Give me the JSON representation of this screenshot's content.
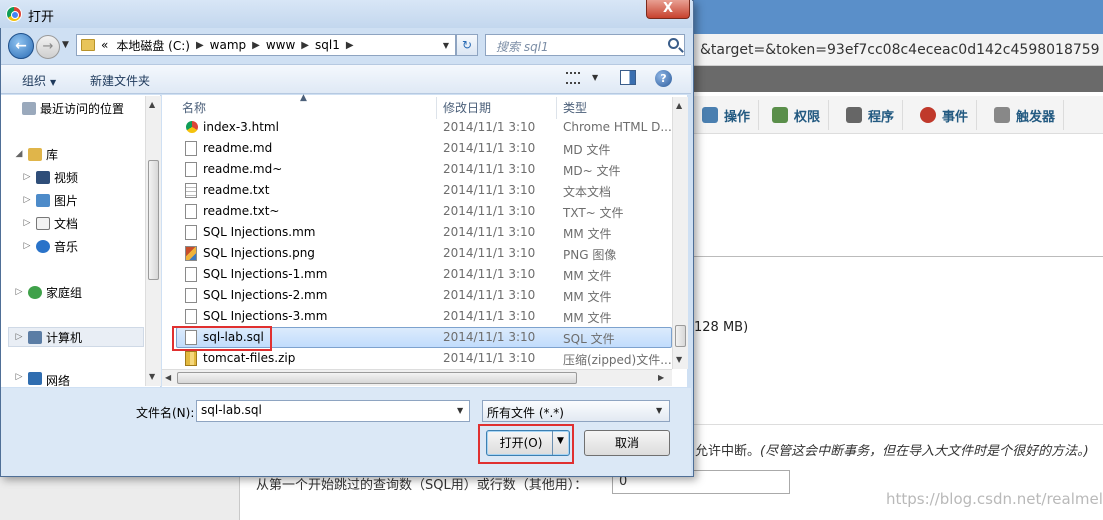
{
  "background": {
    "url_fragment": "&target=&token=93ef7cc08c4eceac0d142c4598018759",
    "tabs": [
      {
        "label": "操作",
        "color": "#4a7fb0"
      },
      {
        "label": "权限",
        "color": "#5a8f4a"
      },
      {
        "label": "程序",
        "color": "#666666"
      },
      {
        "label": "事件",
        "color": "#c0392b"
      },
      {
        "label": "触发器",
        "color": "#888888"
      }
    ],
    "size_text": "128 MB)",
    "note_prefix": "则允许中断。",
    "note_italic": "(尽管这会中断事务，但在导入大文件时是个很好的方法。)",
    "skip_label": "从第一个开始跳过的查询数（SQL用）或行数（其他用）：",
    "skip_value": "0",
    "watermark": "https://blog.csdn.net/realmels"
  },
  "dialog": {
    "title": "打开",
    "close_label": "X",
    "address": {
      "prefix": "«",
      "segments": [
        "本地磁盘 (C:)",
        "wamp",
        "www",
        "sql1"
      ]
    },
    "search_placeholder": "搜索 sql1",
    "toolbar": {
      "organize": "组织",
      "new_folder": "新建文件夹"
    },
    "nav_items": [
      {
        "label": "最近访问的位置",
        "icon": "recent-places-icon",
        "arrow": ""
      },
      {
        "label": "库",
        "icon": "library-icon",
        "arrow": "◢"
      },
      {
        "label": "视频",
        "icon": "video-icon",
        "arrow": "▷"
      },
      {
        "label": "图片",
        "icon": "pictures-icon",
        "arrow": "▷"
      },
      {
        "label": "文档",
        "icon": "documents-icon",
        "arrow": "▷"
      },
      {
        "label": "音乐",
        "icon": "music-icon",
        "arrow": "▷"
      },
      {
        "label": "家庭组",
        "icon": "homegroup-icon",
        "arrow": "▷"
      },
      {
        "label": "计算机",
        "icon": "computer-icon",
        "arrow": "▷"
      },
      {
        "label": "网络",
        "icon": "network-icon",
        "arrow": "▷"
      }
    ],
    "columns": {
      "name": "名称",
      "date": "修改日期",
      "type": "类型"
    },
    "files": [
      {
        "name": "index-3.html",
        "date": "2014/11/1 3:10",
        "type": "Chrome HTML D...",
        "icon": "chrome-file-icon"
      },
      {
        "name": "readme.md",
        "date": "2014/11/1 3:10",
        "type": "MD 文件",
        "icon": "file-icon"
      },
      {
        "name": "readme.md~",
        "date": "2014/11/1 3:10",
        "type": "MD~ 文件",
        "icon": "file-icon"
      },
      {
        "name": "readme.txt",
        "date": "2014/11/1 3:10",
        "type": "文本文档",
        "icon": "text-file-icon"
      },
      {
        "name": "readme.txt~",
        "date": "2014/11/1 3:10",
        "type": "TXT~ 文件",
        "icon": "file-icon"
      },
      {
        "name": "SQL Injections.mm",
        "date": "2014/11/1 3:10",
        "type": "MM 文件",
        "icon": "file-icon"
      },
      {
        "name": "SQL Injections.png",
        "date": "2014/11/1 3:10",
        "type": "PNG 图像",
        "icon": "image-file-icon"
      },
      {
        "name": "SQL Injections-1.mm",
        "date": "2014/11/1 3:10",
        "type": "MM 文件",
        "icon": "file-icon"
      },
      {
        "name": "SQL Injections-2.mm",
        "date": "2014/11/1 3:10",
        "type": "MM 文件",
        "icon": "file-icon"
      },
      {
        "name": "SQL Injections-3.mm",
        "date": "2014/11/1 3:10",
        "type": "MM 文件",
        "icon": "file-icon"
      },
      {
        "name": "sql-lab.sql",
        "date": "2014/11/1 3:10",
        "type": "SQL 文件",
        "icon": "file-icon",
        "selected": true
      },
      {
        "name": "tomcat-files.zip",
        "date": "2014/11/1 3:10",
        "type": "压缩(zipped)文件...",
        "icon": "zip-file-icon"
      }
    ],
    "filename_label": "文件名(N):",
    "filename_value": "sql-lab.sql",
    "filetype_value": "所有文件 (*.*)",
    "open_label": "打开(O)",
    "cancel_label": "取消",
    "highlight_color": "#e03030"
  }
}
